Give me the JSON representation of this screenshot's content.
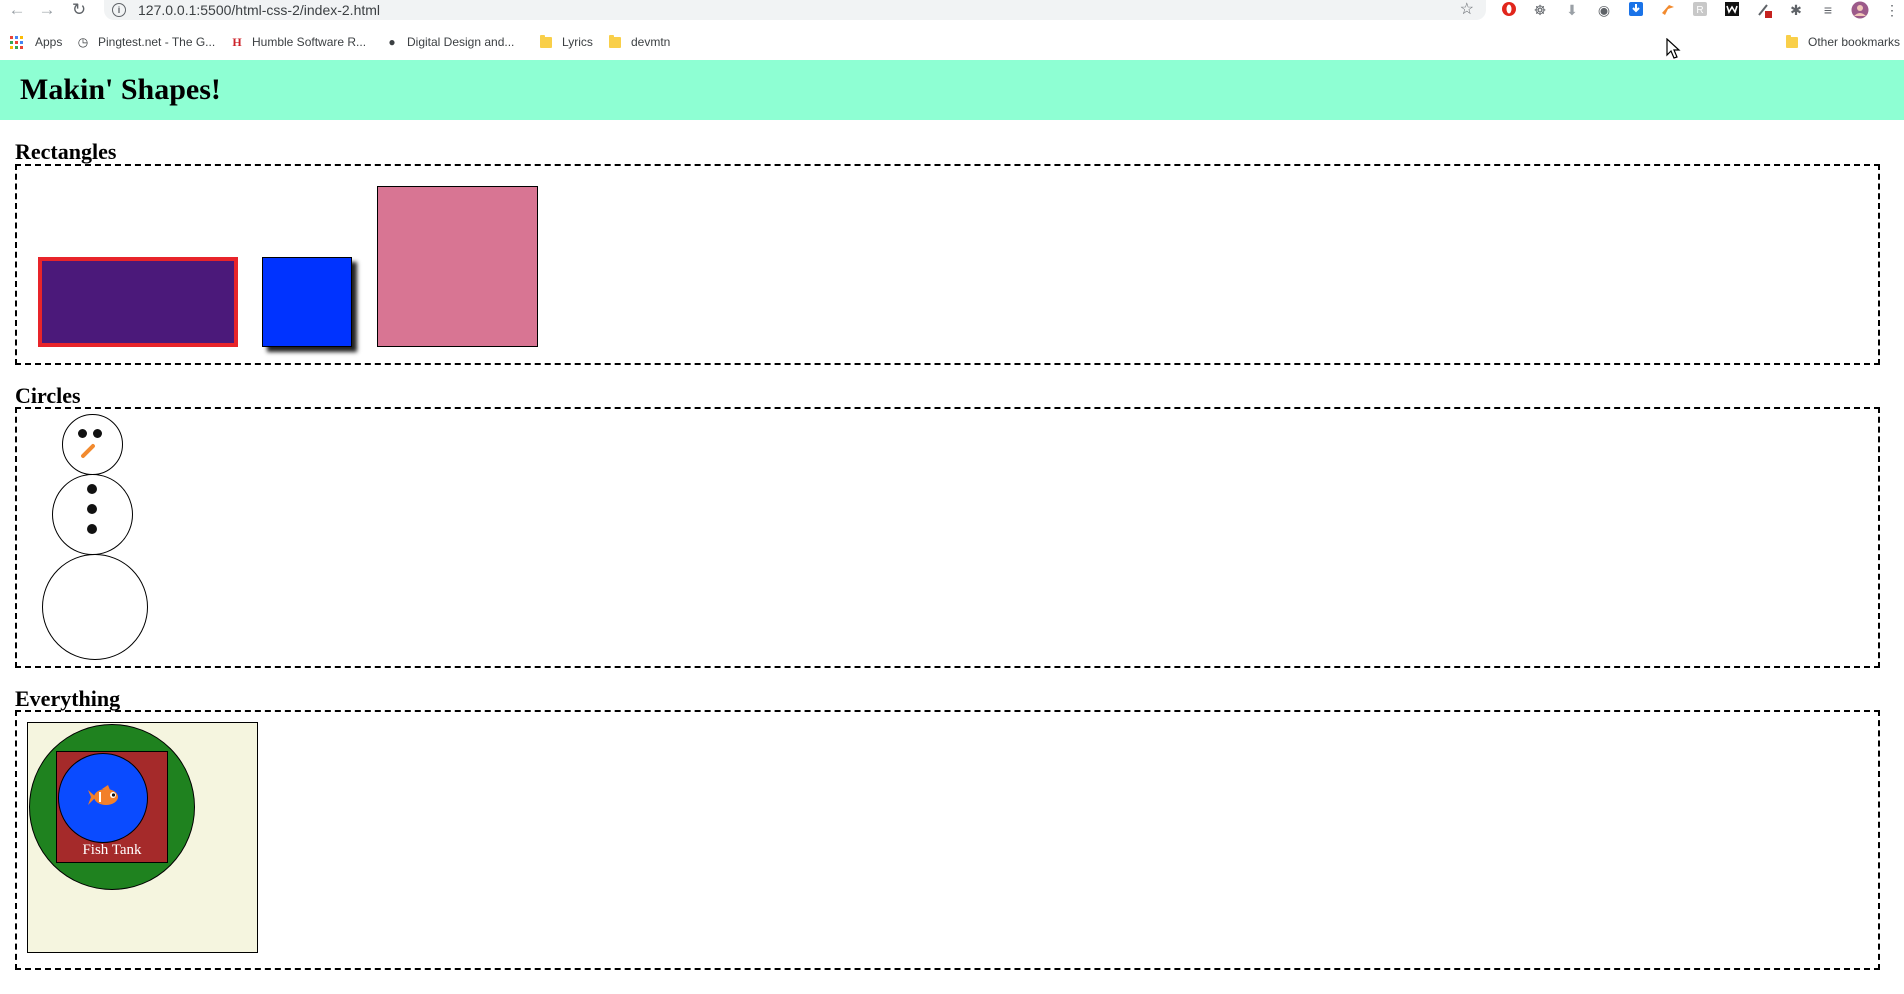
{
  "browser": {
    "url": "127.0.0.1:5500/html-css-2/index-2.html",
    "bookmarks": [
      {
        "label": "Apps"
      },
      {
        "label": "Pingtest.net - The G..."
      },
      {
        "label": "Humble Software R..."
      },
      {
        "label": "Digital Design and..."
      },
      {
        "label": "Lyrics"
      },
      {
        "label": "devmtn"
      }
    ],
    "other_bookmarks": "Other bookmarks"
  },
  "page": {
    "title": "Makin' Shapes!",
    "header_bg": "#8effd3",
    "sections": {
      "rectangles": {
        "title": "Rectangles",
        "colors": {
          "purple": "#4b197a",
          "red_border": "#e8242a",
          "blue": "#0033ff",
          "pink": "#d87593"
        }
      },
      "circles": {
        "title": "Circles",
        "colors": {
          "nose": "#f28a2e"
        }
      },
      "everything": {
        "title": "Everything",
        "fish_tank_label": "Fish Tank",
        "colors": {
          "beige": "#f5f5df",
          "green": "#1f821f",
          "brown": "#a52a2a",
          "blue": "#0a4bff",
          "fish": "#f2802a"
        }
      }
    }
  }
}
